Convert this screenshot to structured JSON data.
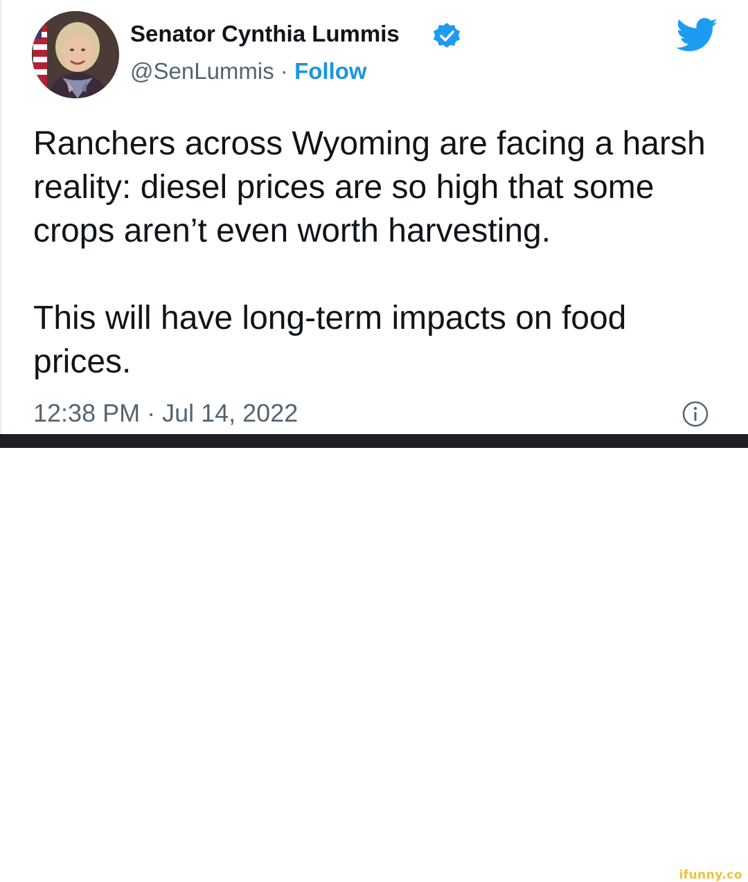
{
  "tweet": {
    "author_name": "Senator Cynthia Lummis",
    "handle": "@SenLummis",
    "separator": "·",
    "follow_label": "Follow",
    "paragraphs": [
      "Ranchers across Wyoming are facing a harsh reality: diesel prices are so high that some crops aren’t even worth harvesting.",
      "This will have long-term impacts on food prices."
    ],
    "timestamp": "12:38 PM · Jul 14, 2022"
  },
  "icons": {
    "verified": "verified-badge-icon",
    "logo": "twitter-bird-icon",
    "info": "info-icon"
  },
  "watermark": "ifunny.co",
  "colors": {
    "accent": "#1d9bf0",
    "follow": "#1b95e0",
    "text": "#0f1419",
    "secondary": "#536471",
    "footer": "#1e1f22",
    "watermark": "#f2c12e"
  }
}
